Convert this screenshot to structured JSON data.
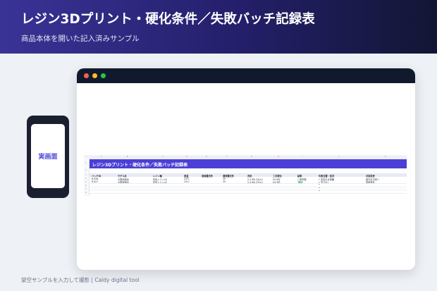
{
  "header": {
    "title": "レジン3Dプリント・硬化条件／失敗バッチ記録表",
    "subtitle": "商品本体を開いた記入済みサンプル"
  },
  "phone": {
    "label": "実画面"
  },
  "sheet": {
    "column_letters": [
      "A",
      "B",
      "C",
      "D",
      "E",
      "F",
      "G",
      "H",
      "I",
      "J",
      "K"
    ],
    "row_numbers": [
      "1",
      "2",
      "3",
      "4",
      "5",
      "6",
      "7",
      "8"
    ],
    "title": "レジン3Dプリント・硬化条件／失敗バッチ記録表",
    "headers": [
      "バッチID",
      "モデル名",
      "レジン種",
      "室温",
      "底面露光秒",
      "通常露光秒",
      "洗浄",
      "二次硬化",
      "結果",
      "失敗位置・症状",
      "次回変更"
    ],
    "rows": [
      [
        "R-026",
        "小物収納台",
        "灰色レジンv2",
        "24℃",
        "",
        "35",
        "2.4 IPA 2分×2",
        "UV 6分",
        "一部失敗",
        "•  支柱の片剥離",
        "露光を中央へ"
      ],
      [
        "R-027",
        "小物収納台",
        "灰色レジンv2",
        "24℃",
        "",
        "35",
        "2.4 IPA 2分×2",
        "UV 6分",
        "成功",
        "•  欠けなし",
        "採用条件"
      ]
    ],
    "empty_bullets": [
      "•",
      "•",
      "•"
    ]
  },
  "footer": {
    "caption": "架空サンプルを入力して撮影 | Caldy digital tool"
  },
  "colors": {
    "header_start": "#3a3397",
    "header_end": "#121633",
    "accent": "#4b3fd6",
    "success": "#1f7a46"
  }
}
